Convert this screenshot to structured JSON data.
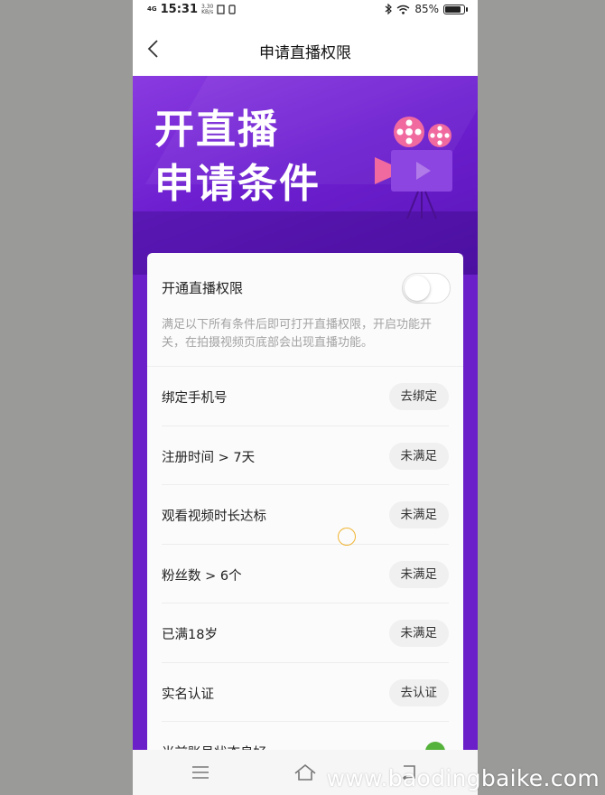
{
  "status": {
    "network": "4G",
    "time": "15:31",
    "speed_value": "3.30",
    "speed_unit": "KB/s",
    "battery_text": "85%",
    "battery_level": 0.85
  },
  "nav": {
    "title": "申请直播权限",
    "back_icon": "chevron-left-icon"
  },
  "hero": {
    "line1": "开直播",
    "line2": "申请条件",
    "illustration_icon": "movie-camera-icon"
  },
  "card": {
    "toggle_label": "开通直播权限",
    "toggle_on": false,
    "description": "满足以下所有条件后即可打开直播权限，开启功能开关，在拍摄视频页底部会出现直播功能。",
    "conditions": [
      {
        "label": "绑定手机号",
        "action": "去绑定"
      },
      {
        "label": "注册时间 > 7天",
        "action": "未满足"
      },
      {
        "label": "观看视频时长达标",
        "action": "未满足"
      },
      {
        "label": "粉丝数 > 6个",
        "action": "未满足"
      },
      {
        "label": "已满18岁",
        "action": "未满足"
      },
      {
        "label": "实名认证",
        "action": "去认证"
      },
      {
        "label": "当前账号状态良好",
        "status_color": "#55b23a"
      }
    ]
  },
  "bottom_nav": {
    "icons": [
      "menu-icon",
      "home-icon",
      "back-icon"
    ]
  },
  "watermark": "www.baodingbaike.com",
  "colors": {
    "primary": "#6a1fc8",
    "success": "#55b23a",
    "touch_indicator": "#f0b535"
  }
}
